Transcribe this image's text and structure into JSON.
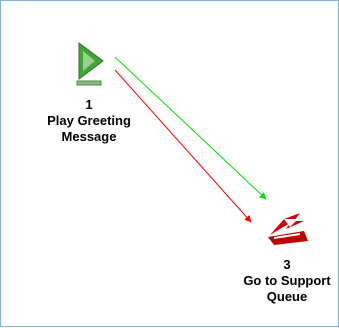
{
  "flow": {
    "nodes": [
      {
        "number": "1",
        "label": "Play Greeting\nMessage",
        "icon": "play-greeting-icon",
        "icon_color": "#3fa535"
      },
      {
        "number": "3",
        "label": "Go to Support\nQueue",
        "icon": "queue-transfer-icon",
        "icon_color": "#d00000"
      }
    ],
    "connectors": [
      {
        "from": "1",
        "to": "3",
        "color": "#00dd00"
      },
      {
        "from": "1",
        "to": "3",
        "color": "#ff0000"
      }
    ]
  }
}
